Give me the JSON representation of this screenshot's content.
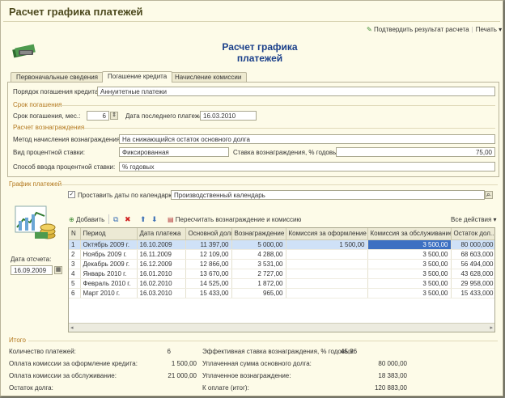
{
  "window_title": "Расчет графика платежей",
  "command_bar": {
    "confirm_label": "Подтвердить результат расчета",
    "print_label": "Печать"
  },
  "header_title_line1": "Расчет графика",
  "header_title_line2": "платежей",
  "tabs": [
    {
      "label": "Первоначальные сведения"
    },
    {
      "label": "Погашение кредита"
    },
    {
      "label": "Начисление комиссии"
    }
  ],
  "form": {
    "order_label": "Порядок погашения кредита:",
    "order_value": "Аннуитетные платежи",
    "term_section": "Срок погашения",
    "term_label": "Срок погашения, мес.:",
    "term_value": "6",
    "last_payment_label": "Дата последнего платежа:",
    "last_payment_value": "16.03.2010",
    "reward_section": "Расчет вознаграждения",
    "method_label": "Метод начисления вознаграждения:",
    "method_value": "На снижающийся остаток основного долга",
    "rate_type_label": "Вид процентной ставки:",
    "rate_type_value": "Фиксированная",
    "rate_label": "Ставка вознаграждения, % годовых:",
    "rate_value": "75,00",
    "input_method_label": "Способ ввода процентной ставки:",
    "input_method_value": "% годовых"
  },
  "schedule": {
    "section": "График платежей",
    "calendar_checkbox_label": "Проставить даты по календарю",
    "calendar_value": "Производственный календарь",
    "report_date_label": "Дата отсчета:",
    "report_date_value": "16.09.2009",
    "toolbar": {
      "add_label": "Добавить",
      "recalc_label": "Пересчитать вознаграждение и комиссию",
      "all_actions_label": "Все действия"
    },
    "columns": [
      "N",
      "Период",
      "Дата платежа",
      "Основной долг",
      "Вознаграждение",
      "Комиссия за оформление",
      "Комиссия за обслуживание",
      "Остаток дол..."
    ],
    "rows": [
      {
        "n": "1",
        "period": "Октябрь 2009 г.",
        "date": "16.10.2009",
        "principal": "11 397,00",
        "reward": "5 000,00",
        "fee_setup": "1 500,00",
        "fee_service": "3 500,00",
        "balance": "80 000,000"
      },
      {
        "n": "2",
        "period": "Ноябрь 2009 г.",
        "date": "16.11.2009",
        "principal": "12 109,00",
        "reward": "4 288,00",
        "fee_setup": "",
        "fee_service": "3 500,00",
        "balance": "68 603,000"
      },
      {
        "n": "3",
        "period": "Декабрь 2009 г.",
        "date": "16.12.2009",
        "principal": "12 866,00",
        "reward": "3 531,00",
        "fee_setup": "",
        "fee_service": "3 500,00",
        "balance": "56 494,000"
      },
      {
        "n": "4",
        "period": "Январь 2010 г.",
        "date": "16.01.2010",
        "principal": "13 670,00",
        "reward": "2 727,00",
        "fee_setup": "",
        "fee_service": "3 500,00",
        "balance": "43 628,000"
      },
      {
        "n": "5",
        "period": "Февраль 2010 г.",
        "date": "16.02.2010",
        "principal": "14 525,00",
        "reward": "1 872,00",
        "fee_setup": "",
        "fee_service": "3 500,00",
        "balance": "29 958,000"
      },
      {
        "n": "6",
        "period": "Март 2010 г.",
        "date": "16.03.2010",
        "principal": "15 433,00",
        "reward": "965,00",
        "fee_setup": "",
        "fee_service": "3 500,00",
        "balance": "15 433,000"
      }
    ]
  },
  "totals": {
    "section": "Итого",
    "count_label": "Количество платежей:",
    "count_value": "6",
    "fee_setup_label": "Оплата комиссии за оформление кредита:",
    "fee_setup_value": "1 500,00",
    "fee_service_label": "Оплата комиссии за обслуживание:",
    "fee_service_value": "21 000,00",
    "balance_label": "Остаток долга:",
    "eff_rate_label": "Эффективная ставка вознаграждения, % годовых:",
    "eff_rate_value": "45,96",
    "paid_principal_label": "Уплаченная сумма основного долга:",
    "paid_principal_value": "80 000,00",
    "paid_reward_label": "Уплаченное вознаграждение:",
    "paid_reward_value": "18 383,00",
    "to_pay_label": "К оплате (итог):",
    "to_pay_value": "120 883,00"
  }
}
